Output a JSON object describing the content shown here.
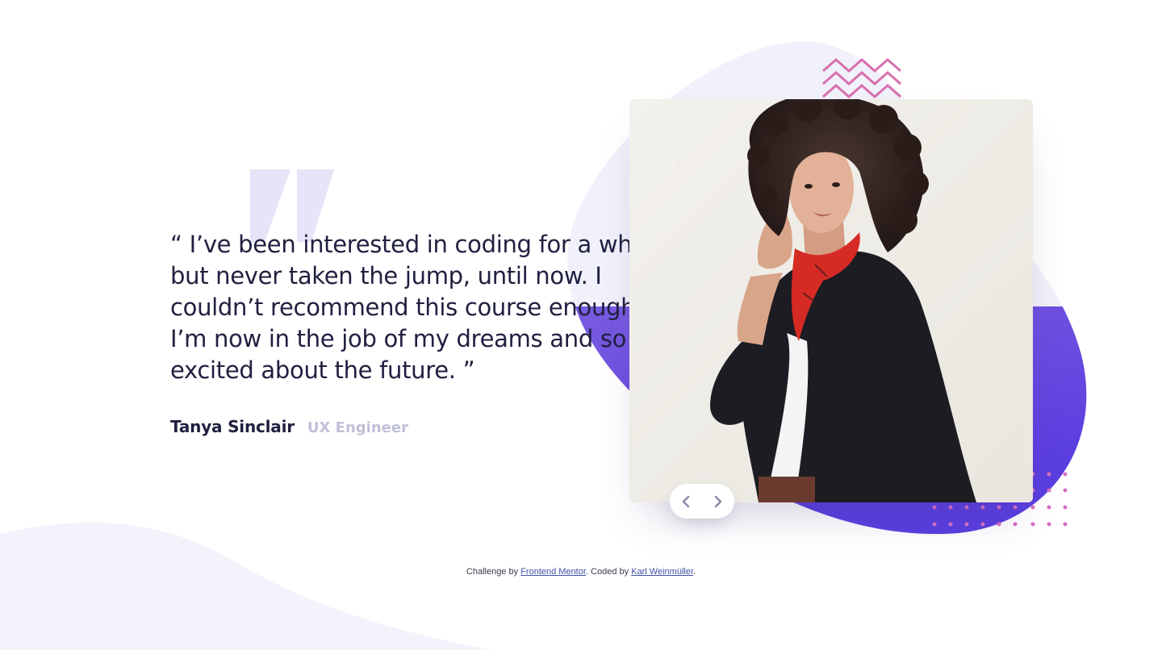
{
  "testimonial": {
    "quote": "“ I’ve been interested in coding for a while but never taken the jump, until now. I couldn’t recommend this course enough. I’m now in the job of my dreams and so excited about the future. ”",
    "author_name": "Tanya Sinclair",
    "author_role": "UX Engineer"
  },
  "photo": {
    "alt": "Tanya Sinclair"
  },
  "navigation": {
    "prev_icon": "chevron-left-icon",
    "next_icon": "chevron-right-icon"
  },
  "footer": {
    "prefix": "Challenge by ",
    "link1": "Frontend Mentor",
    "middle": ". Coded by ",
    "link2": "Karl Weinmüller",
    "suffix": "."
  },
  "colors": {
    "text_dark": "#202040",
    "text_muted": "#c0c0d8",
    "accent_purple": "#6b4de6",
    "accent_pink": "#d36aa8",
    "bg_soft": "#f1f1fb"
  }
}
